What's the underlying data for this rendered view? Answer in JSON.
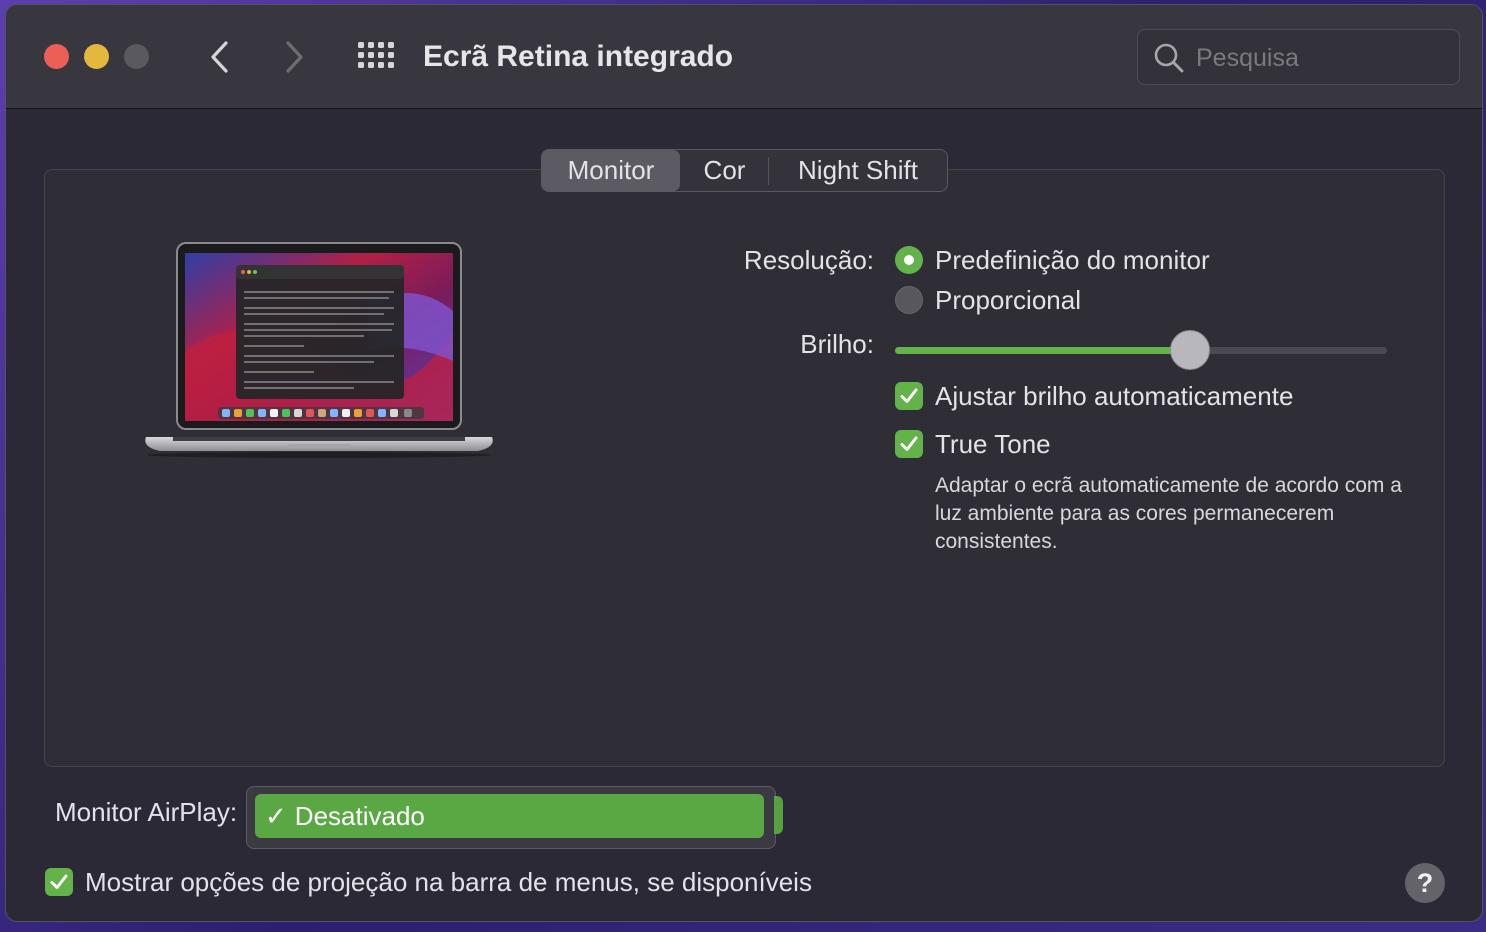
{
  "window": {
    "title": "Ecrã Retina integrado",
    "search_placeholder": "Pesquisa"
  },
  "icons": {
    "close": "close-icon",
    "minimize": "minimize-icon",
    "zoom": "zoom-icon",
    "back": "chevron-left-icon",
    "forward": "chevron-right-icon",
    "grid": "grid-icon",
    "search": "search-icon",
    "checkmark": "checkmark-icon",
    "help": "help-icon"
  },
  "tabs": [
    {
      "label": "Monitor",
      "selected": true
    },
    {
      "label": "Cor",
      "selected": false
    },
    {
      "label": "Night Shift",
      "selected": false
    }
  ],
  "display": {
    "resolution_label": "Resolução:",
    "resolution_options": [
      {
        "label": "Predefinição do monitor",
        "selected": true
      },
      {
        "label": "Proporcional",
        "selected": false
      }
    ],
    "brightness_label": "Brilho:",
    "brightness_level": 0.6,
    "auto_brightness_label": "Ajustar brilho automaticamente",
    "auto_brightness_checked": true,
    "true_tone_label": "True Tone",
    "true_tone_checked": true,
    "true_tone_description": "Adaptar o ecrã automaticamente de acordo com a luz ambiente para as cores permanecerem consistentes."
  },
  "airplay": {
    "label": "Monitor AirPlay:",
    "selected_option": "Desativado",
    "check_glyph": "✓"
  },
  "mirroring": {
    "label": "Mostrar opções de projeção na barra de menus, se disponíveis",
    "checked": true
  },
  "help_glyph": "?",
  "colors": {
    "accent_green": "#63b24a",
    "close_red": "#ec5f57",
    "minimize_yellow": "#e4b83c"
  }
}
